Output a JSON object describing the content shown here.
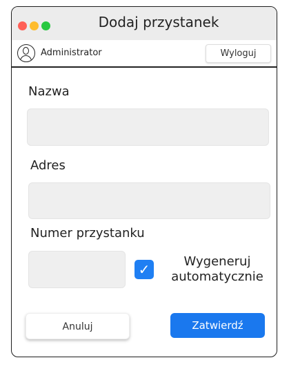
{
  "window": {
    "title": "Dodaj przystanek"
  },
  "user": {
    "name": "Administrator",
    "logout_label": "Wyloguj"
  },
  "form": {
    "name_label": "Nazwa",
    "name_value": "",
    "address_label": "Adres",
    "address_value": "",
    "stop_number_label": "Numer przystanku",
    "stop_number_value": "",
    "auto_generate_line1": "Wygeneruj",
    "auto_generate_line2": "automatycznie",
    "auto_generate_checked": true
  },
  "actions": {
    "cancel_label": "Anuluj",
    "submit_label": "Zatwierdź"
  },
  "colors": {
    "accent": "#1a78ee",
    "checkbox": "#1f7ff3",
    "field_bg": "#efefef"
  },
  "icons": [
    "close-dot",
    "minimize-dot",
    "maximize-dot",
    "user-icon",
    "checkmark-icon"
  ]
}
